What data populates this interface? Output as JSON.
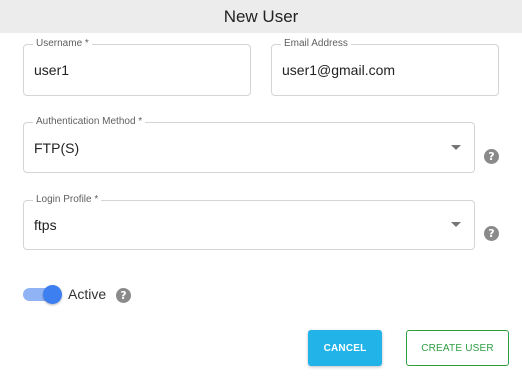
{
  "dialog": {
    "title": "New User"
  },
  "fields": {
    "username": {
      "label": "Username *",
      "value": "user1"
    },
    "email": {
      "label": "Email Address",
      "value": "user1@gmail.com"
    },
    "auth_method": {
      "label": "Authentication Method *",
      "value": "FTP(S)"
    },
    "login_profile": {
      "label": "Login Profile *",
      "value": "ftps"
    }
  },
  "active": {
    "label": "Active",
    "checked": true
  },
  "help_glyph": "?",
  "buttons": {
    "cancel": "CANCEL",
    "create": "CREATE USER"
  },
  "colors": {
    "cancel_bg": "#22b4e9",
    "create_border": "#2e9e43",
    "toggle_on": "#3d7ef0"
  }
}
